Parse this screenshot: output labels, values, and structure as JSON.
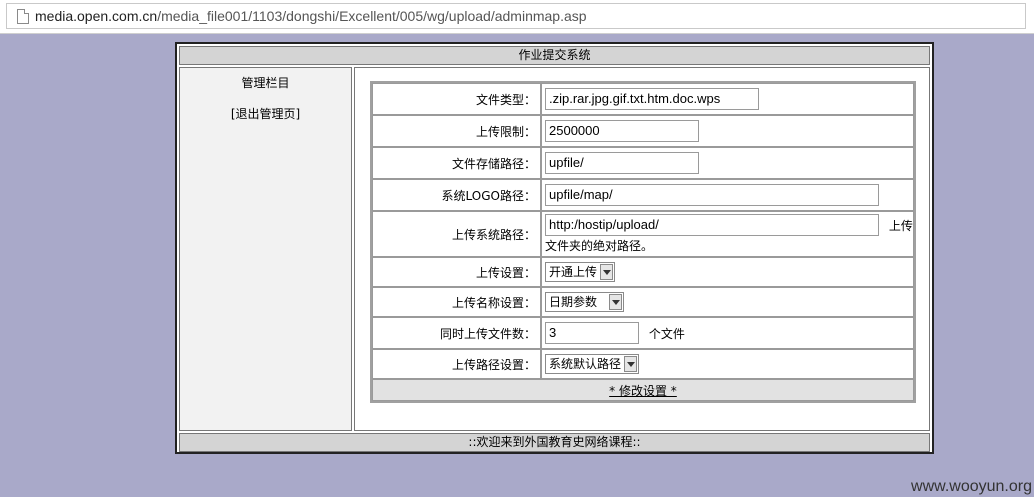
{
  "browser": {
    "url_host": "media.open.com.cn",
    "url_path": "/media_file001/1103/dongshi/Excellent/005/wg/upload/adminmap.asp"
  },
  "page": {
    "title": "作业提交系统",
    "footer": "::欢迎来到外国教育史网络课程::"
  },
  "sidebar": {
    "title": "管理栏目",
    "logout": "[退出管理页]"
  },
  "settings": {
    "file_types": {
      "label": "文件类型：",
      "value": ".zip.rar.jpg.gif.txt.htm.doc.wps"
    },
    "upload_limit": {
      "label": "上传限制：",
      "value": "2500000"
    },
    "storage_path": {
      "label": "文件存储路径：",
      "value": "upfile/"
    },
    "logo_path": {
      "label": "系统LOGO路径：",
      "value": "upfile/map/"
    },
    "system_path": {
      "label": "上传系统路径：",
      "value": "http:/hostip/upload/",
      "note_part1": "上传",
      "note_part2": "文件夹的绝对路径。"
    },
    "upload_setting": {
      "label": "上传设置：",
      "value": "开通上传"
    },
    "name_setting": {
      "label": "上传名称设置：",
      "value": "日期参数"
    },
    "concurrent": {
      "label": "同时上传文件数：",
      "value": "3",
      "unit": "个文件"
    },
    "path_setting": {
      "label": "上传路径设置：",
      "value": "系统默认路径"
    },
    "submit": "* 修改设置 *"
  },
  "watermark": "www.wooyun.org"
}
